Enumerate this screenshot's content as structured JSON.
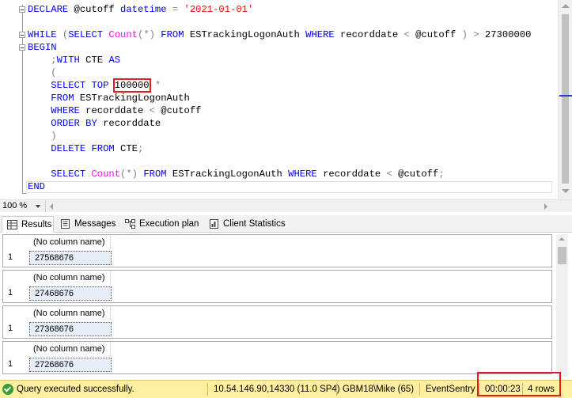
{
  "editor": {
    "lines": [
      [
        {
          "c": "kw",
          "t": "DECLARE "
        },
        {
          "c": "tx",
          "t": "@cutoff "
        },
        {
          "c": "kw",
          "t": "datetime "
        },
        {
          "c": "op",
          "t": "= "
        },
        {
          "c": "str",
          "t": "'2021-01-01'"
        }
      ],
      [],
      [
        {
          "c": "kw",
          "t": "WHILE "
        },
        {
          "c": "op",
          "t": "("
        },
        {
          "c": "kw",
          "t": "SELECT "
        },
        {
          "c": "fn",
          "t": "Count"
        },
        {
          "c": "op",
          "t": "(*) "
        },
        {
          "c": "kw",
          "t": "FROM "
        },
        {
          "c": "tx",
          "t": "ESTrackingLogonAuth "
        },
        {
          "c": "kw",
          "t": "WHERE "
        },
        {
          "c": "tx",
          "t": "recorddate "
        },
        {
          "c": "op",
          "t": "< "
        },
        {
          "c": "tx",
          "t": "@cutoff "
        },
        {
          "c": "op",
          "t": ") > "
        },
        {
          "c": "tx",
          "t": "27300000"
        }
      ],
      [
        {
          "c": "kw",
          "t": "BEGIN"
        }
      ],
      [
        {
          "c": "tx",
          "t": "    "
        },
        {
          "c": "op",
          "t": ";"
        },
        {
          "c": "kw",
          "t": "WITH "
        },
        {
          "c": "tx",
          "t": "CTE "
        },
        {
          "c": "kw",
          "t": "AS"
        }
      ],
      [
        {
          "c": "tx",
          "t": "    "
        },
        {
          "c": "op",
          "t": "("
        }
      ],
      [
        {
          "c": "tx",
          "t": "    "
        },
        {
          "c": "kw",
          "t": "SELECT TOP "
        },
        {
          "c": "tx",
          "t": "100000",
          "hl": true
        },
        {
          "c": "tx",
          "t": " "
        },
        {
          "c": "op",
          "t": "*"
        }
      ],
      [
        {
          "c": "tx",
          "t": "    "
        },
        {
          "c": "kw",
          "t": "FROM "
        },
        {
          "c": "tx",
          "t": "ESTrackingLogonAuth"
        }
      ],
      [
        {
          "c": "tx",
          "t": "    "
        },
        {
          "c": "kw",
          "t": "WHERE "
        },
        {
          "c": "tx",
          "t": "recorddate "
        },
        {
          "c": "op",
          "t": "< "
        },
        {
          "c": "tx",
          "t": "@cutoff"
        }
      ],
      [
        {
          "c": "tx",
          "t": "    "
        },
        {
          "c": "kw",
          "t": "ORDER BY "
        },
        {
          "c": "tx",
          "t": "recorddate"
        }
      ],
      [
        {
          "c": "tx",
          "t": "    "
        },
        {
          "c": "op",
          "t": ")"
        }
      ],
      [
        {
          "c": "tx",
          "t": "    "
        },
        {
          "c": "kw",
          "t": "DELETE FROM "
        },
        {
          "c": "tx",
          "t": "CTE"
        },
        {
          "c": "op",
          "t": ";"
        }
      ],
      [],
      [
        {
          "c": "tx",
          "t": "    "
        },
        {
          "c": "kw",
          "t": "SELECT "
        },
        {
          "c": "fn",
          "t": "Count"
        },
        {
          "c": "op",
          "t": "(*) "
        },
        {
          "c": "kw",
          "t": "FROM "
        },
        {
          "c": "tx",
          "t": "ESTrackingLogonAuth "
        },
        {
          "c": "kw",
          "t": "WHERE "
        },
        {
          "c": "tx",
          "t": "recorddate "
        },
        {
          "c": "op",
          "t": "< "
        },
        {
          "c": "tx",
          "t": "@cutoff"
        },
        {
          "c": "op",
          "t": ";"
        }
      ],
      [
        {
          "c": "kw",
          "t": "END"
        }
      ]
    ],
    "zoom": "100 %"
  },
  "tabs": {
    "results": "Results",
    "messages": "Messages",
    "execution_plan": "Execution plan",
    "client_statistics": "Client Statistics"
  },
  "results": {
    "grids": [
      {
        "header": "(No column name)",
        "row_number": "1",
        "value": "27568676"
      },
      {
        "header": "(No column name)",
        "row_number": "1",
        "value": "27468676"
      },
      {
        "header": "(No column name)",
        "row_number": "1",
        "value": "27368676"
      },
      {
        "header": "(No column name)",
        "row_number": "1",
        "value": "27268676"
      }
    ]
  },
  "status": {
    "message": "Query executed successfully.",
    "server": "10.54.146.90,14330 (11.0 SP4)",
    "user": "GBM18\\Mike (65)",
    "database": "EventSentry",
    "elapsed": "00:00:23",
    "rows": "4 rows"
  },
  "colors": {
    "keyword": "#0000ff",
    "function": "#ff00ff",
    "string": "#ff0000",
    "operator": "#808080",
    "status_bar": "#ffef9e",
    "highlight_box": "#e11d1d"
  }
}
